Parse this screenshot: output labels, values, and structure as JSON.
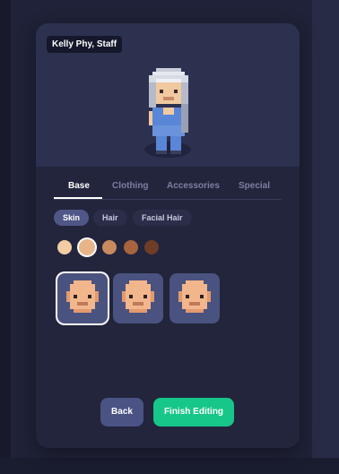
{
  "character": {
    "name_tag": "Kelly Phy, Staff"
  },
  "tabs": [
    {
      "label": "Base",
      "active": true
    },
    {
      "label": "Clothing",
      "active": false
    },
    {
      "label": "Accessories",
      "active": false
    },
    {
      "label": "Special",
      "active": false
    }
  ],
  "subtabs": [
    {
      "label": "Skin",
      "active": true
    },
    {
      "label": "Hair",
      "active": false
    },
    {
      "label": "Facial Hair",
      "active": false
    }
  ],
  "skin_colors": [
    "#f2cda3",
    "#e8b58a",
    "#c98a5e",
    "#a8643f",
    "#6e3d26"
  ],
  "selected_skin_index": 1,
  "face_options_count": 3,
  "selected_face_index": 0,
  "buttons": {
    "back": "Back",
    "finish": "Finish Editing"
  },
  "colors": {
    "accent": "#17c689",
    "panel": "#2d3150",
    "selected_tile": "#4a5280"
  }
}
